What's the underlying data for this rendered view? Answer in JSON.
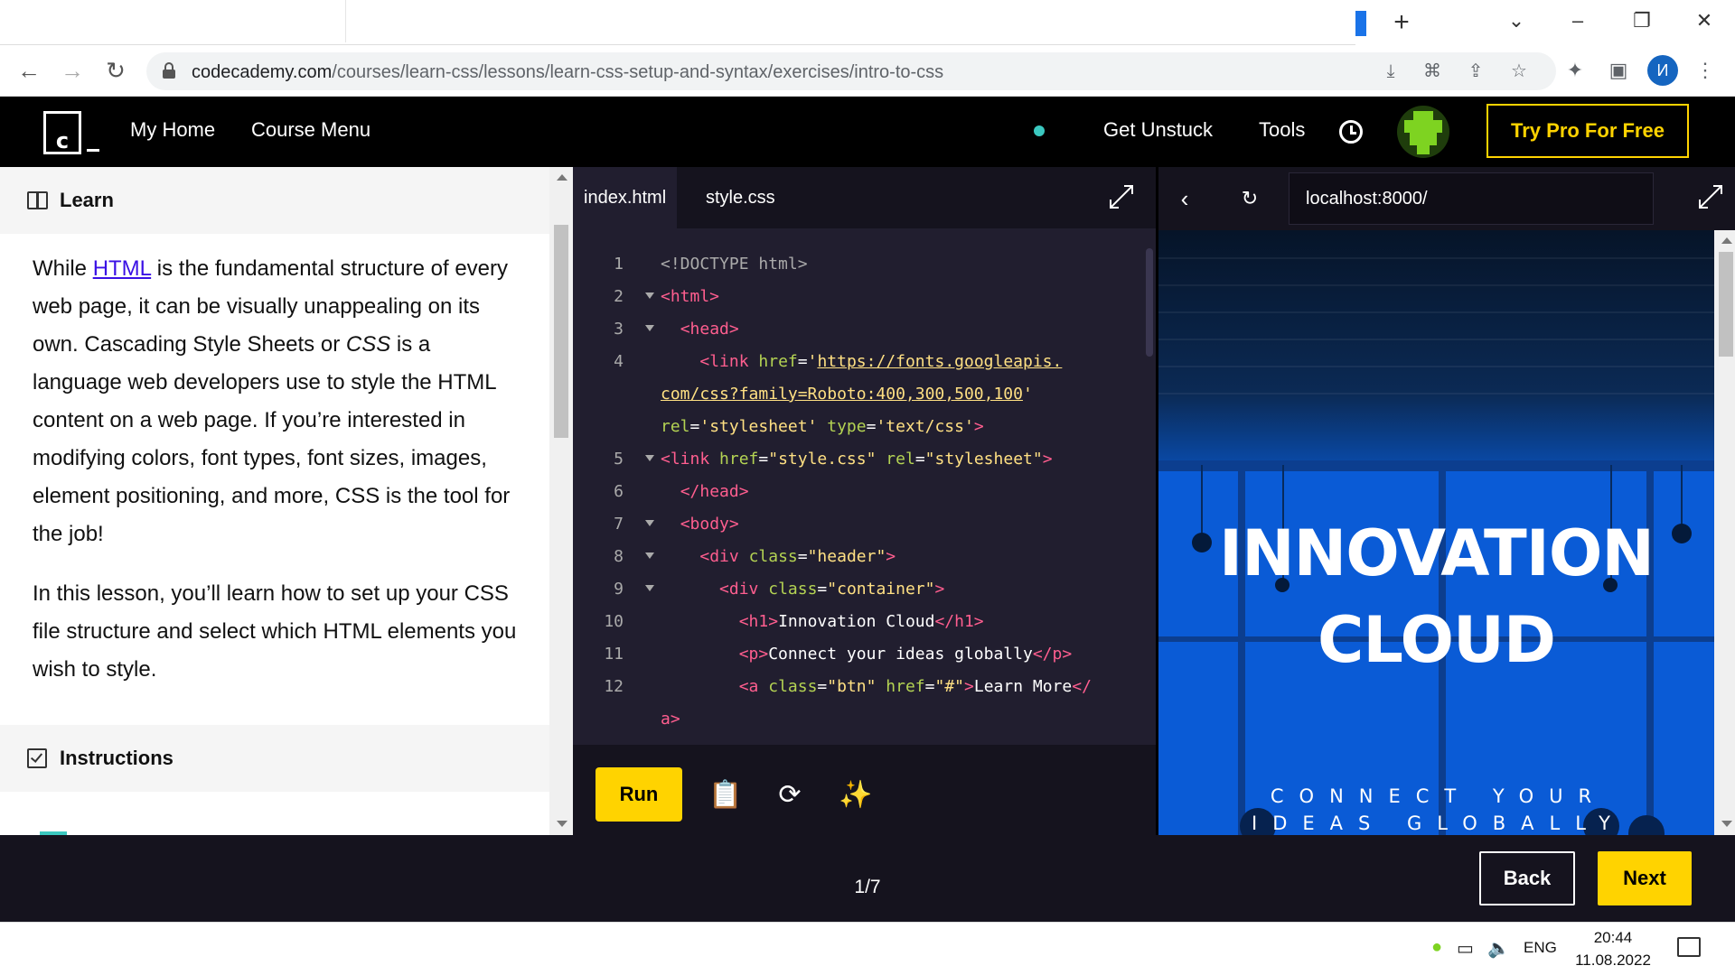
{
  "browser": {
    "url_domain": "codecademy.com",
    "url_path": "/courses/learn-css/lessons/learn-css-setup-and-syntax/exercises/intro-to-css",
    "profile_initial": "И"
  },
  "header": {
    "logo_letter": "c",
    "my_home": "My Home",
    "course_menu": "Course Menu",
    "get_unstuck": "Get Unstuck",
    "tools": "Tools",
    "try_pro": "Try Pro For Free"
  },
  "learn": {
    "title": "Learn",
    "p1_a": "While ",
    "p1_link": "HTML",
    "p1_b": " is the fundamental structure of every web page, it can be visually unappealing on its own. Cascading Style Sheets or ",
    "p1_em": "CSS",
    "p1_c": " is a language web developers use to style the HTML content on a web page. If you’re interested in modifying colors, font types, font sizes, images, element positioning, and more, CSS is the tool for the job!",
    "p2": "In this lesson, you’ll learn how to set up your CSS file structure and select which HTML elements you wish to style.",
    "instructions_title": "Instructions"
  },
  "editor": {
    "tabs": [
      "index.html",
      "style.css"
    ],
    "run": "Run"
  },
  "code": {
    "l1": "<!DOCTYPE html>",
    "l4a_url1": "https://fonts.googleapis.",
    "l4b_url2": "com/css?family=Roboto:400,300,500,100",
    "l4c_rel": "'stylesheet'",
    "l4c_type": "'text/css'",
    "l5_href": "\"style.css\"",
    "l5_rel": "\"stylesheet\"",
    "l8_class": "\"header\"",
    "l9_class": "\"container\"",
    "l10_text": "Innovation Cloud",
    "l11_text": "Connect your ideas globally",
    "l12_class": "\"btn\"",
    "l12_href": "\"#\"",
    "l12_text": "Learn More"
  },
  "preview": {
    "url": "localhost:8000/",
    "hero_title_1": "INNOVATION",
    "hero_title_2": "CLOUD",
    "hero_sub": "CONNECT YOUR IDEAS GLOBALLY"
  },
  "footer": {
    "progress": "1/7",
    "back": "Back",
    "next": "Next"
  },
  "taskbar": {
    "lang": "ENG",
    "time": "20:44",
    "date": "11.08.2022"
  },
  "colors": {
    "accent_yellow": "#ffd300",
    "header_bg": "#000000",
    "editor_bg": "#211e2f",
    "preview_blue": "#0a5bd6",
    "link_purple": "#3a10e5"
  }
}
